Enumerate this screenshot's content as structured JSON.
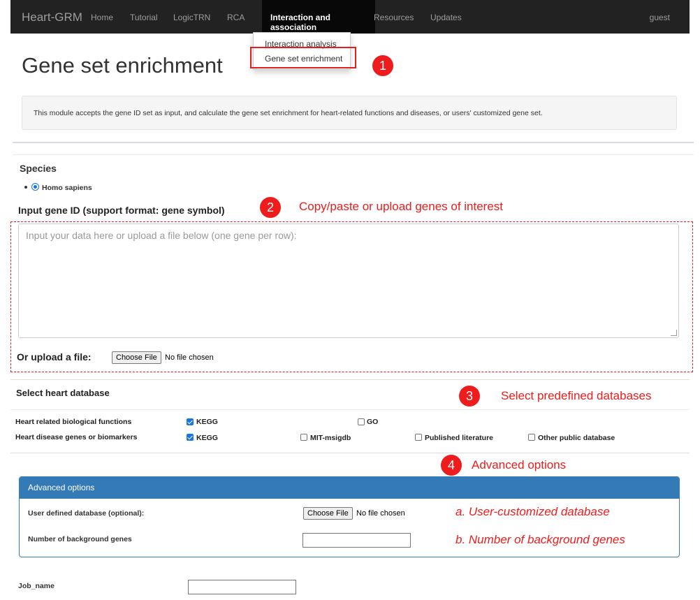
{
  "navbar": {
    "brand": "Heart-GRM",
    "items": [
      "Home",
      "Tutorial",
      "LogicTRN",
      "RCA",
      "Interaction and association",
      "Resources",
      "Updates"
    ],
    "user": "guest"
  },
  "dropdown": {
    "items": [
      "Interaction analysis",
      "Gene set enrichment"
    ]
  },
  "annotations": {
    "step1": "1",
    "step2": "2",
    "step2_text": "Copy/paste or upload genes of interest",
    "step3": "3",
    "step3_text": "Select predefined databases",
    "step4": "4",
    "step4_text": "Advanced options",
    "a_text": "a. User-customized database",
    "b_text": "b. Number of background genes"
  },
  "page": {
    "title": "Gene set enrichment",
    "description": "This module accepts the gene ID set as input, and calculate the gene set enrichment for heart-related functions and diseases, or users' customized gene set."
  },
  "species": {
    "heading": "Species",
    "option": "Homo sapiens",
    "selected": true
  },
  "input": {
    "heading": "Input gene ID (support format: gene symbol)",
    "placeholder": "Input your data here or upload a file below (one gene per row):",
    "value": "",
    "upload_label": "Or upload a file:",
    "file_button": "Choose File",
    "file_status": "No file chosen"
  },
  "database": {
    "heading": "Select heart database",
    "rows": [
      {
        "label": "Heart related biological functions",
        "options": [
          {
            "label": "KEGG",
            "checked": true
          },
          {
            "label": "GO",
            "checked": false
          }
        ]
      },
      {
        "label": "Heart disease genes or biomarkers",
        "options": [
          {
            "label": "KEGG",
            "checked": true
          },
          {
            "label": "MIT-msigdb",
            "checked": false
          },
          {
            "label": "Published literature",
            "checked": false
          },
          {
            "label": "Other public database",
            "checked": false
          }
        ]
      }
    ]
  },
  "advanced": {
    "heading": "Advanced options",
    "user_db_label": "User defined database (optional):",
    "file_button": "Choose File",
    "file_status": "No file chosen",
    "bg_genes_label": "Number of background genes",
    "bg_genes_value": ""
  },
  "job": {
    "label": "Job_name",
    "value": ""
  },
  "colors": {
    "navbar": "#222222",
    "navbar_active": "#080808",
    "annotation_red": "#ee1c1c",
    "panel_blue": "#337ab7",
    "checkbox_blue": "#1a73e8"
  }
}
